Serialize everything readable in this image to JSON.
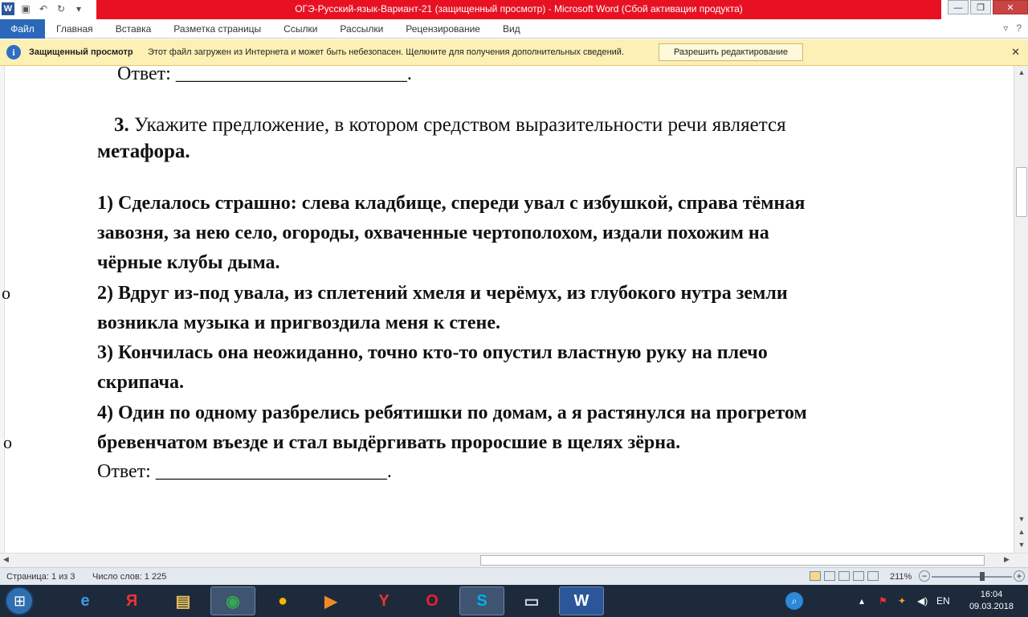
{
  "window": {
    "title": "ОГЭ-Русский-язык-Вариант-21 (защищенный просмотр) - Microsoft Word (Сбой активации продукта)",
    "app_icon": "W"
  },
  "ribbon": {
    "file_tab": "Файл",
    "tabs": [
      "Главная",
      "Вставка",
      "Разметка страницы",
      "Ссылки",
      "Рассылки",
      "Рецензирование",
      "Вид"
    ]
  },
  "protected_bar": {
    "title": "Защищенный просмотр",
    "message": "Этот файл загружен из Интернета и может быть небезопасен. Щелкните для получения дополнительных сведений.",
    "button": "Разрешить редактирование"
  },
  "document": {
    "prev_answer": "Ответ: ________________________.",
    "q3_number": "3.",
    "q3_text": " Укажите предложение, в котором средством выразительности речи является",
    "q3_term": "метафора.",
    "options": [
      "1) Сделалось страшно: слева кладбище, спереди увал с избушкой, справа тёмная",
      "завозня, за нею село, огороды, охваченные чертополохом, издали похожим на",
      "чёрные клубы дыма.",
      "2) Вдруг из-под увала, из сплетений хмеля и черёмух, из глубокого нутра земли",
      "возникла музыка и пригвоздила меня к стене.",
      "3) Кончилась она неожиданно, точно кто-то опустил властную руку на плечо",
      "скрипача.",
      "4) Один по одному разбрелись ребятишки по домам, а я растянулся на прогретом",
      "бревенчатом въезде и стал выдёргивать проросшие в щелях зёрна."
    ],
    "answer": "Ответ: ________________________.",
    "stray_chars": [
      "о",
      "о"
    ]
  },
  "status": {
    "page": "Страница: 1 из 3",
    "words": "Число слов: 1 225",
    "zoom": "211%"
  },
  "taskbar": {
    "time": "16:04",
    "date": "09.03.2018"
  }
}
